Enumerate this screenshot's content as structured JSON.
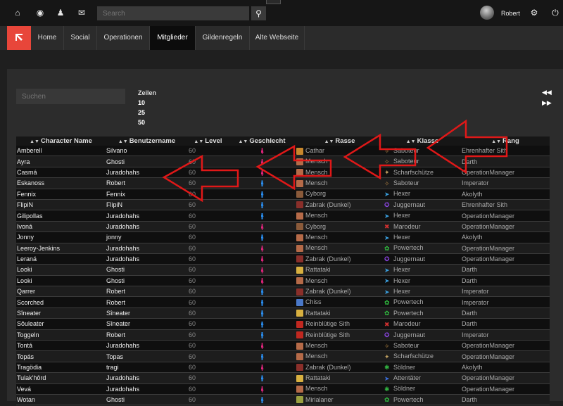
{
  "topbar": {
    "icons": [
      "home-icon",
      "globe-icon",
      "user-icon",
      "mail-icon"
    ],
    "search_placeholder": "Search",
    "username": "Robert",
    "right_icons": [
      "gear-icon",
      "power-icon"
    ]
  },
  "nav": {
    "tabs": [
      "Home",
      "Social",
      "Operationen",
      "Mitglieder",
      "Gildenregeln",
      "Alte Webseite"
    ],
    "active": "Mitglieder"
  },
  "controls": {
    "search_placeholder": "Suchen",
    "rows_label": "Zeilen",
    "rows_options": [
      "10",
      "25",
      "50"
    ],
    "prev_icon": "double-left-icon",
    "next_icon": "double-right-icon"
  },
  "table": {
    "headers": [
      "Character Name",
      "Benutzername",
      "Level",
      "Geschlecht",
      "Rasse",
      "Klasse",
      "Rang"
    ],
    "rows": [
      {
        "name": "Amberell",
        "user": "Silvano",
        "level": "60",
        "gender": "f",
        "race": "Cathar",
        "class": "Saboteur",
        "rank": "Ehrenhafter Sith"
      },
      {
        "name": "Ayra",
        "user": "Ghosti",
        "level": "60",
        "gender": "f",
        "race": "Mensch",
        "class": "Saboteur",
        "rank": "Darth"
      },
      {
        "name": "Casmá",
        "user": "Juradohahs",
        "level": "60",
        "gender": "f",
        "race": "Mensch",
        "class": "Scharfschütze",
        "rank": "OperationManager"
      },
      {
        "name": "Eskanoss",
        "user": "Robert",
        "level": "60",
        "gender": "m",
        "race": "Mensch",
        "class": "Saboteur",
        "rank": "Imperator"
      },
      {
        "name": "Fennix",
        "user": "Fennix",
        "level": "60",
        "gender": "m",
        "race": "Cyborg",
        "class": "Hexer",
        "rank": "Akolyth"
      },
      {
        "name": "FlipiN",
        "user": "FlipiN",
        "level": "60",
        "gender": "m",
        "race": "Zabrak (Dunkel)",
        "class": "Juggernaut",
        "rank": "Ehrenhafter Sith"
      },
      {
        "name": "Gilipollas",
        "user": "Juradohahs",
        "level": "60",
        "gender": "m",
        "race": "Mensch",
        "class": "Hexer",
        "rank": "OperationManager"
      },
      {
        "name": "Ivoná",
        "user": "Juradohahs",
        "level": "60",
        "gender": "f",
        "race": "Cyborg",
        "class": "Marodeur",
        "rank": "OperationManager"
      },
      {
        "name": "Jonny",
        "user": "jonny",
        "level": "60",
        "gender": "m",
        "race": "Mensch",
        "class": "Hexer",
        "rank": "Akolyth"
      },
      {
        "name": "Leeroy-Jenkins",
        "user": "Juradohahs",
        "level": "60",
        "gender": "f",
        "race": "Mensch",
        "class": "Powertech",
        "rank": "OperationManager"
      },
      {
        "name": "Leraná",
        "user": "Juradohahs",
        "level": "60",
        "gender": "f",
        "race": "Zabrak (Dunkel)",
        "class": "Juggernaut",
        "rank": "OperationManager"
      },
      {
        "name": "Looki",
        "user": "Ghosti",
        "level": "60",
        "gender": "f",
        "race": "Rattataki",
        "class": "Hexer",
        "rank": "Darth"
      },
      {
        "name": "Looki",
        "user": "Ghosti",
        "level": "60",
        "gender": "f",
        "race": "Mensch",
        "class": "Hexer",
        "rank": "Darth"
      },
      {
        "name": "Qarrer",
        "user": "Robert",
        "level": "60",
        "gender": "m",
        "race": "Zabrak (Dunkel)",
        "class": "Hexer",
        "rank": "Imperator"
      },
      {
        "name": "Scorched",
        "user": "Robert",
        "level": "60",
        "gender": "m",
        "race": "Chiss",
        "class": "Powertech",
        "rank": "Imperator"
      },
      {
        "name": "Sîneater",
        "user": "Sîneater",
        "level": "60",
        "gender": "m",
        "race": "Rattataki",
        "class": "Powertech",
        "rank": "Darth"
      },
      {
        "name": "Sôuleater",
        "user": "Sîneater",
        "level": "60",
        "gender": "m",
        "race": "Reinblütige Sith",
        "class": "Marodeur",
        "rank": "Darth"
      },
      {
        "name": "Toggeln",
        "user": "Robert",
        "level": "60",
        "gender": "m",
        "race": "Reinblütige Sith",
        "class": "Juggernaut",
        "rank": "Imperator"
      },
      {
        "name": "Tontá",
        "user": "Juradohahs",
        "level": "60",
        "gender": "f",
        "race": "Mensch",
        "class": "Saboteur",
        "rank": "OperationManager"
      },
      {
        "name": "Topás",
        "user": "Topas",
        "level": "60",
        "gender": "m",
        "race": "Mensch",
        "class": "Scharfschütze",
        "rank": "OperationManager"
      },
      {
        "name": "Tragödia",
        "user": "tragi",
        "level": "60",
        "gender": "f",
        "race": "Zabrak (Dunkel)",
        "class": "Söldner",
        "rank": "Akolyth"
      },
      {
        "name": "Tulak'hôrd",
        "user": "Juradohahs",
        "level": "60",
        "gender": "m",
        "race": "Rattataki",
        "class": "Attentäter",
        "rank": "OperationManager"
      },
      {
        "name": "Vevá",
        "user": "Juradohahs",
        "level": "60",
        "gender": "f",
        "race": "Mensch",
        "class": "Söldner",
        "rank": "OperationManager"
      },
      {
        "name": "Wotan",
        "user": "Ghosti",
        "level": "60",
        "gender": "m",
        "race": "Mirialaner",
        "class": "Powertech",
        "rank": "Darth"
      }
    ]
  },
  "colors": {
    "accent": "#e8463a",
    "female": "#e0257c",
    "male": "#2a8ef0",
    "annotation_arrows": "#e01818"
  }
}
